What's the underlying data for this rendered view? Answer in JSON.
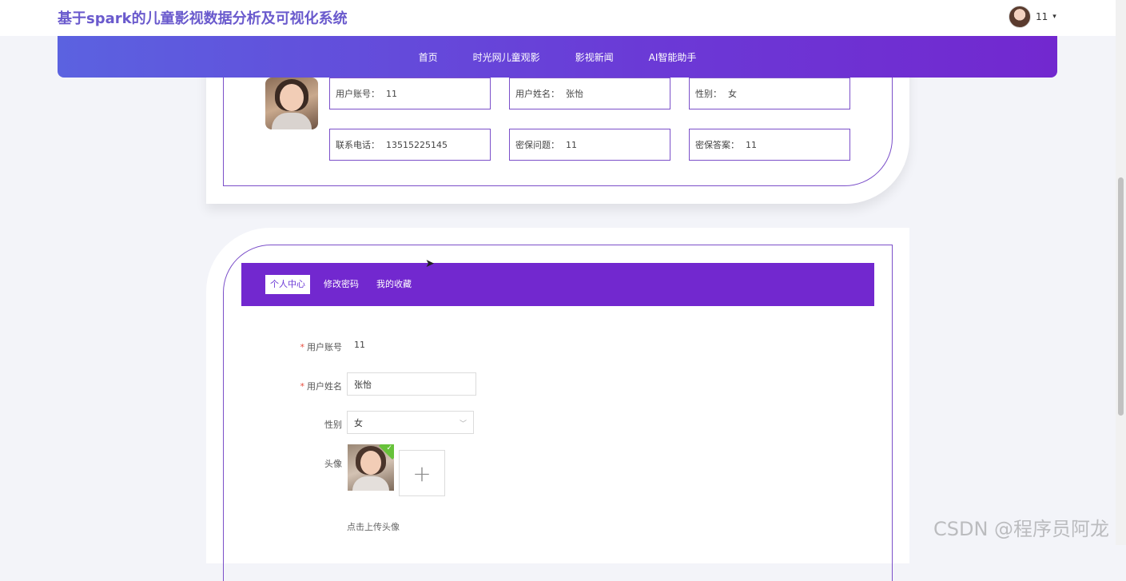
{
  "header": {
    "site_title": "基于spark的儿童影视数据分析及可视化系统",
    "user_name": "11",
    "caret": "▾"
  },
  "nav": {
    "items": [
      "首页",
      "时光网儿童观影",
      "影视新闻",
      "AI智能助手"
    ]
  },
  "profile_card": {
    "fields": [
      {
        "label": "用户账号：",
        "value": "11"
      },
      {
        "label": "用户姓名：",
        "value": "张怡"
      },
      {
        "label": "性别：",
        "value": "女"
      },
      {
        "label": "联系电话：",
        "value": "13515225145"
      },
      {
        "label": "密保问题：",
        "value": "11"
      },
      {
        "label": "密保答案：",
        "value": "11"
      }
    ]
  },
  "tabs": {
    "items": [
      "个人中心",
      "修改密码",
      "我的收藏"
    ],
    "active_index": 0
  },
  "form": {
    "required_mark": "*",
    "account_label": "用户账号",
    "account_value": "11",
    "name_label": "用户姓名",
    "name_value": "张怡",
    "gender_label": "性别",
    "gender_value": "女",
    "avatar_label": "头像",
    "upload_plus": "+",
    "upload_hint": "点击上传头像"
  },
  "watermark": "CSDN @程序员阿龙",
  "colors": {
    "accent": "#7228cf",
    "nav_start": "#5b62e0",
    "title": "#6a5acd",
    "success": "#67c23a"
  }
}
